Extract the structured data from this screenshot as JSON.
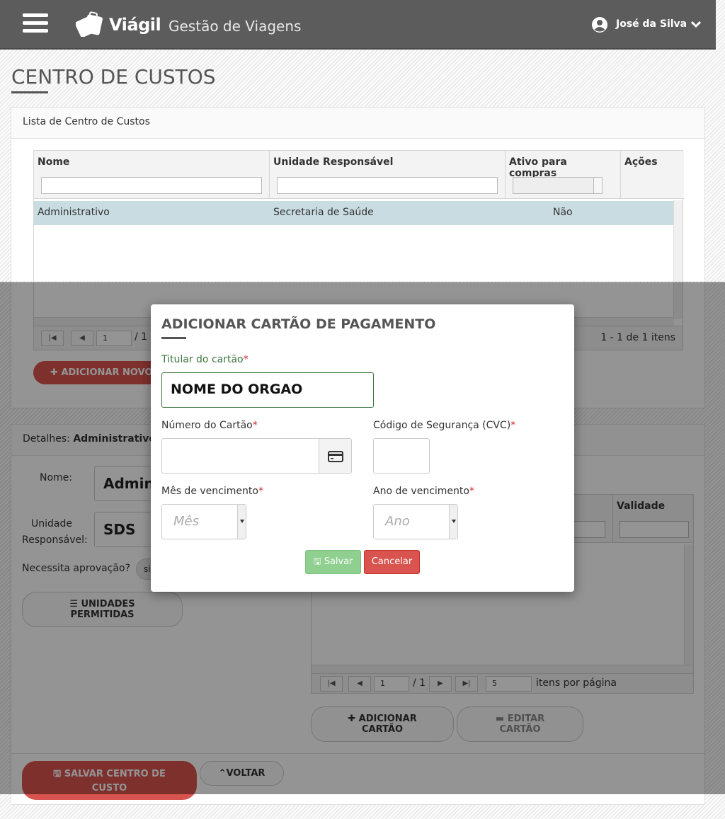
{
  "header": {
    "brand": "Viágil",
    "subtitle": "Gestão de Viagens",
    "user_name": "José da Silva"
  },
  "page": {
    "title": "CENTRO DE CUSTOS"
  },
  "list_panel": {
    "title": "Lista de Centro de Custos",
    "columns": [
      "Nome",
      "Unidade Responsável",
      "Ativo para compras",
      "Ações"
    ],
    "rows": [
      {
        "nome": "Administrativo",
        "unidade": "Secretaria de Saúde",
        "ativo": "Não"
      }
    ],
    "pager": {
      "page": "1",
      "of": "/ 1",
      "info": "1 - 1 de 1 itens"
    },
    "add_button": "ADICIONAR NOVO"
  },
  "details_panel": {
    "title_prefix": "Detalhes:",
    "title_value": "Administrativo",
    "nome_label": "Nome:",
    "nome_value": "Adminis",
    "unidade_label_1": "Unidade",
    "unidade_label_2": "Responsável:",
    "unidade_value": "SDS",
    "aprovacao_label": "Necessita aprovação?",
    "aprovacao_value": "si",
    "unidades_button": "UNIDADES PERMITIDAS",
    "validade_header": "Validade",
    "pager": {
      "page": "1",
      "of": "/ 1",
      "page_size": "5",
      "info": "itens por página"
    },
    "add_card_button": "ADICIONAR CARTÃO",
    "edit_card_button": "EDITAR CARTÃO",
    "save_button": "SALVAR CENTRO DE CUSTO",
    "back_button": "VOLTAR"
  },
  "modal": {
    "title": "ADICIONAR CARTÃO DE PAGAMENTO",
    "titular_label": "Titular do cartão",
    "titular_value": "NOME DO ORGAO",
    "numero_label": "Número do Cartão",
    "cvc_label": "Código de Segurança (CVC)",
    "mes_label": "Mês de vencimento",
    "mes_placeholder": "Mês",
    "ano_label": "Ano de vencimento",
    "ano_placeholder": "Ano",
    "required_mark": "*",
    "save_button": "Salvar",
    "cancel_button": "Cancelar"
  },
  "colors": {
    "header_bg": "#5c5c5c",
    "danger": "#d9534f",
    "success_light": "#8fcf8f",
    "selected_row": "#c9dce2",
    "valid_green": "#3c763d"
  },
  "icons": [
    "menu-icon",
    "suitcase-logo-icon",
    "user-circle-icon",
    "chevron-down-icon",
    "credit-card-icon",
    "plus-icon",
    "list-icon",
    "save-icon",
    "chevron-up-icon"
  ]
}
